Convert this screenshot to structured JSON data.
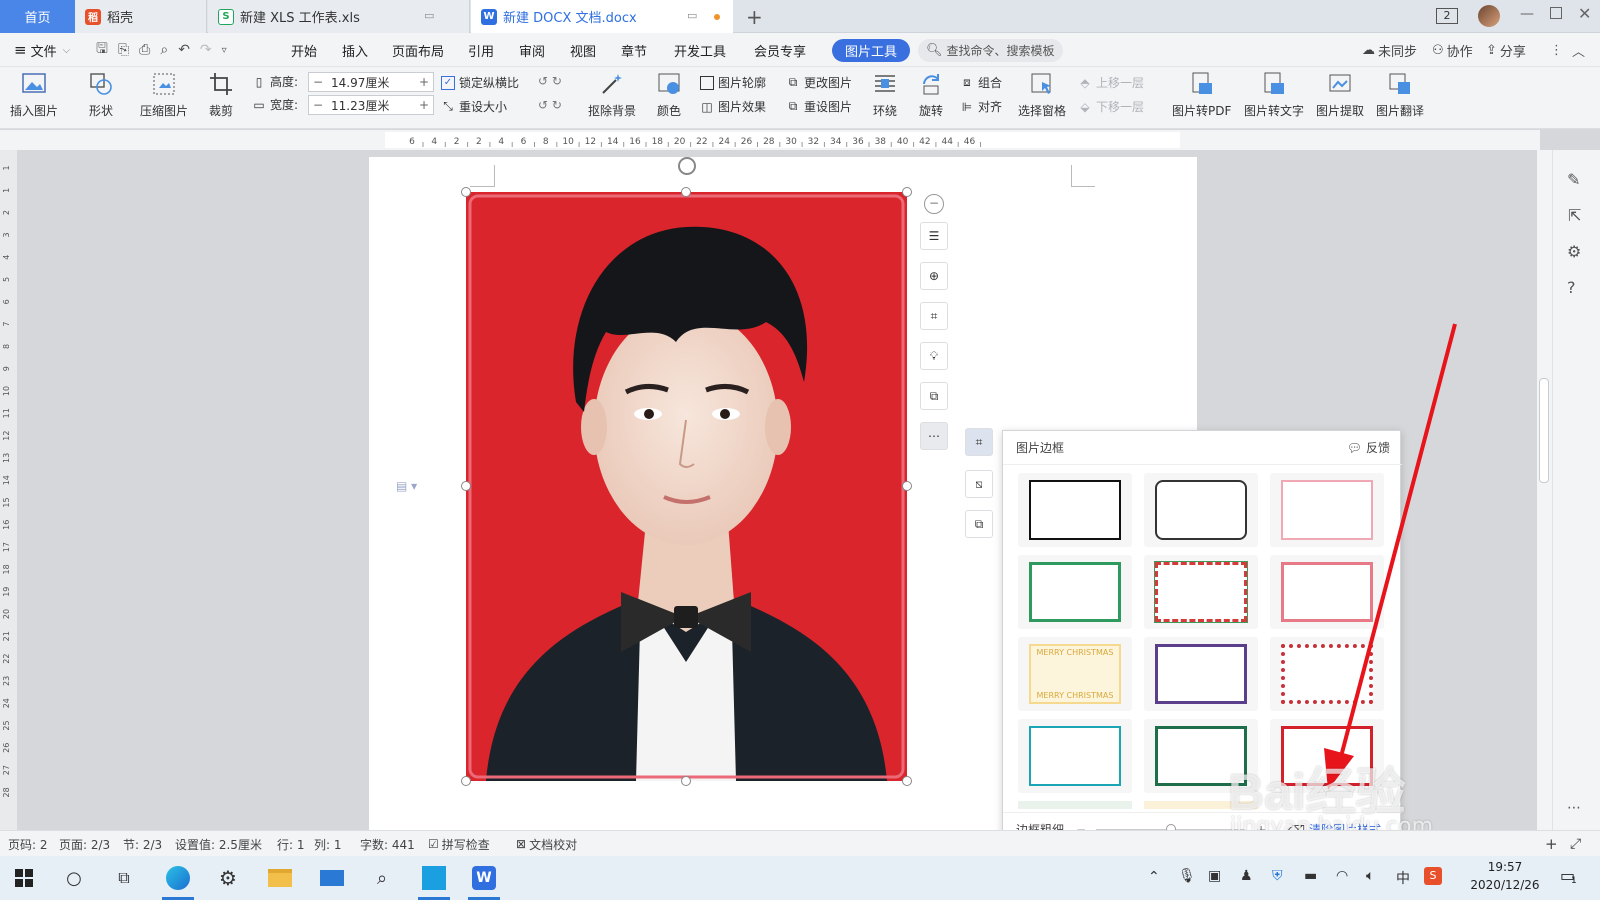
{
  "tabs": {
    "home": "首页",
    "daoke": "稻壳",
    "xls": "新建 XLS 工作表.xls",
    "docx": "新建 DOCX 文档.docx",
    "window_count": "2"
  },
  "menu": {
    "file": "文件",
    "items": [
      "开始",
      "插入",
      "页面布局",
      "引用",
      "审阅",
      "视图",
      "章节",
      "开发工具",
      "会员专享"
    ],
    "active": "图片工具",
    "search": "查找命令、搜索模板",
    "sync": "未同步",
    "collab": "协作",
    "share": "分享"
  },
  "ribbon": {
    "insert_image": "插入图片",
    "shape": "形状",
    "compress": "压缩图片",
    "crop": "裁剪",
    "height_label": "高度:",
    "height_value": "14.97厘米",
    "width_label": "宽度:",
    "width_value": "11.23厘米",
    "lock_ratio": "锁定纵横比",
    "reset_size": "重设大小",
    "remove_bg": "抠除背景",
    "color": "颜色",
    "outline": "图片轮廓",
    "effect": "图片效果",
    "change_pic": "更改图片",
    "reset_pic": "重设图片",
    "wrap": "环绕",
    "rotate": "旋转",
    "group": "组合",
    "align": "对齐",
    "select_pane": "选择窗格",
    "move_up": "上移一层",
    "move_down": "下移一层",
    "to_pdf": "图片转PDF",
    "to_text": "图片转文字",
    "extract": "图片提取",
    "translate": "图片翻译"
  },
  "ruler": {
    "marks": [
      "6",
      "4",
      "2",
      "2",
      "4",
      "6",
      "8",
      "10",
      "12",
      "14",
      "16",
      "18",
      "20",
      "22",
      "24",
      "26",
      "28",
      "30",
      "32",
      "34",
      "36",
      "38",
      "40",
      "42",
      "44",
      "46"
    ],
    "vmarks": [
      "1",
      "1",
      "2",
      "3",
      "4",
      "5",
      "6",
      "7",
      "8",
      "9",
      "10",
      "11",
      "12",
      "13",
      "14",
      "15",
      "16",
      "17",
      "18",
      "19",
      "20",
      "21",
      "22",
      "23",
      "24",
      "25",
      "26",
      "27",
      "28"
    ]
  },
  "panel": {
    "title": "图片边框",
    "feedback": "反馈",
    "merry_top": "MERRY CHRISTMAS",
    "merry_bottom": "MERRY CHRISTMAS",
    "thickness": "边框粗细",
    "clear": "清除图片样式"
  },
  "status": {
    "page_no": "页码: 2",
    "pages": "页面: 2/3",
    "section": "节: 2/3",
    "setting": "设置值: 2.5厘米",
    "row": "行: 1",
    "col": "列: 1",
    "words": "字数: 441",
    "spell": "拼写检查",
    "proof": "文档校对"
  },
  "watermark": {
    "brand": "Bai经验",
    "url": "jingyan.baidu.com"
  },
  "taskbar": {
    "time": "19:57",
    "date": "2020/12/26",
    "ime": "中",
    "notif_count": "1"
  },
  "colors": {
    "accent": "#3a6fe0",
    "photo_bg": "#d9252b",
    "arrow": "#e8141b"
  }
}
